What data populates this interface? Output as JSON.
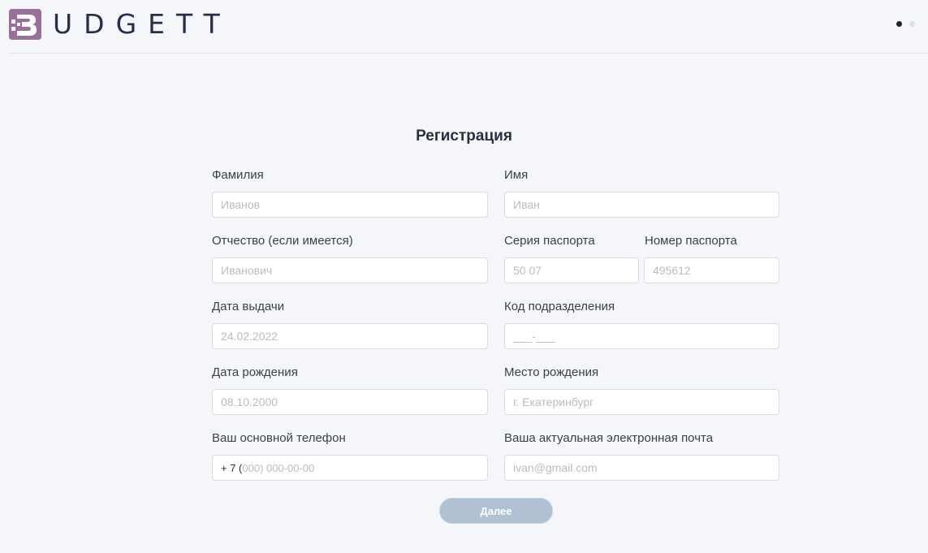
{
  "header": {
    "logo_text": "UDGETT",
    "brand_color": "#9a6f99",
    "pagination": {
      "total": 2,
      "active": 1
    }
  },
  "form": {
    "title": "Регистрация",
    "fields": {
      "last_name": {
        "label": "Фамилия",
        "placeholder": "Иванов"
      },
      "first_name": {
        "label": "Имя",
        "placeholder": "Иван"
      },
      "patronymic": {
        "label": "Отчество (если имеется)",
        "placeholder": "Иванович"
      },
      "passport_series": {
        "label": "Серия паспорта",
        "placeholder": "50 07"
      },
      "passport_number": {
        "label": "Номер паспорта",
        "placeholder": "495612"
      },
      "issue_date": {
        "label": "Дата выдачи",
        "placeholder": "24.02.2022"
      },
      "division_code": {
        "label": "Код подразделения",
        "placeholder": "___-___"
      },
      "birth_date": {
        "label": "Дата рождения",
        "placeholder": "08.10.2000"
      },
      "birth_place": {
        "label": "Место рождения",
        "placeholder": "г. Екатеринбург"
      },
      "phone": {
        "label": "Ваш основной телефон",
        "prefix": "+ 7 (",
        "placeholder": "000) 000-00-00"
      },
      "email": {
        "label": "Ваша актуальная электронная почта",
        "placeholder": "ivan@gmail.com"
      }
    },
    "submit_label": "Далее"
  }
}
